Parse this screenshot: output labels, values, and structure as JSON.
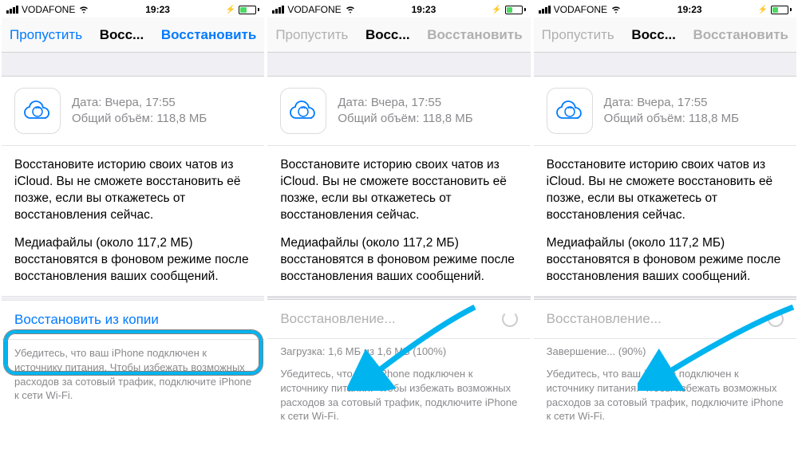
{
  "status": {
    "carrier": "VODAFONE",
    "time": "19:23"
  },
  "nav": {
    "left": "Пропустить",
    "title": "Восс...",
    "right": "Восстановить"
  },
  "backup": {
    "date_label": "Дата: Вчера, 17:55",
    "size_label": "Общий объём: 118,8 МБ"
  },
  "body": {
    "p1": "Восстановите историю своих чатов из iCloud. Вы не сможете восстановить её позже, если вы откажетесь от восстановления сейчас.",
    "p2": "Медиафайлы (около 117,2 МБ) восстановятся в фоновом режиме после восстановления ваших сообщений."
  },
  "screens": [
    {
      "restore_label": "Восстановить из копии",
      "restore_state": "active",
      "progress": null,
      "highlight": true,
      "arrow": false
    },
    {
      "restore_label": "Восстановление...",
      "restore_state": "loading",
      "progress": "Загрузка: 1,6 МБ из 1,6 МБ (100%)",
      "highlight": false,
      "arrow": true
    },
    {
      "restore_label": "Восстановление...",
      "restore_state": "loading",
      "progress": "Завершение... (90%)",
      "highlight": false,
      "arrow": true
    }
  ],
  "footer": "Убедитесь, что ваш iPhone подключен к источнику питания. Чтобы избежать возможных расходов за сотовый трафик, подключите iPhone к сети Wi-Fi."
}
